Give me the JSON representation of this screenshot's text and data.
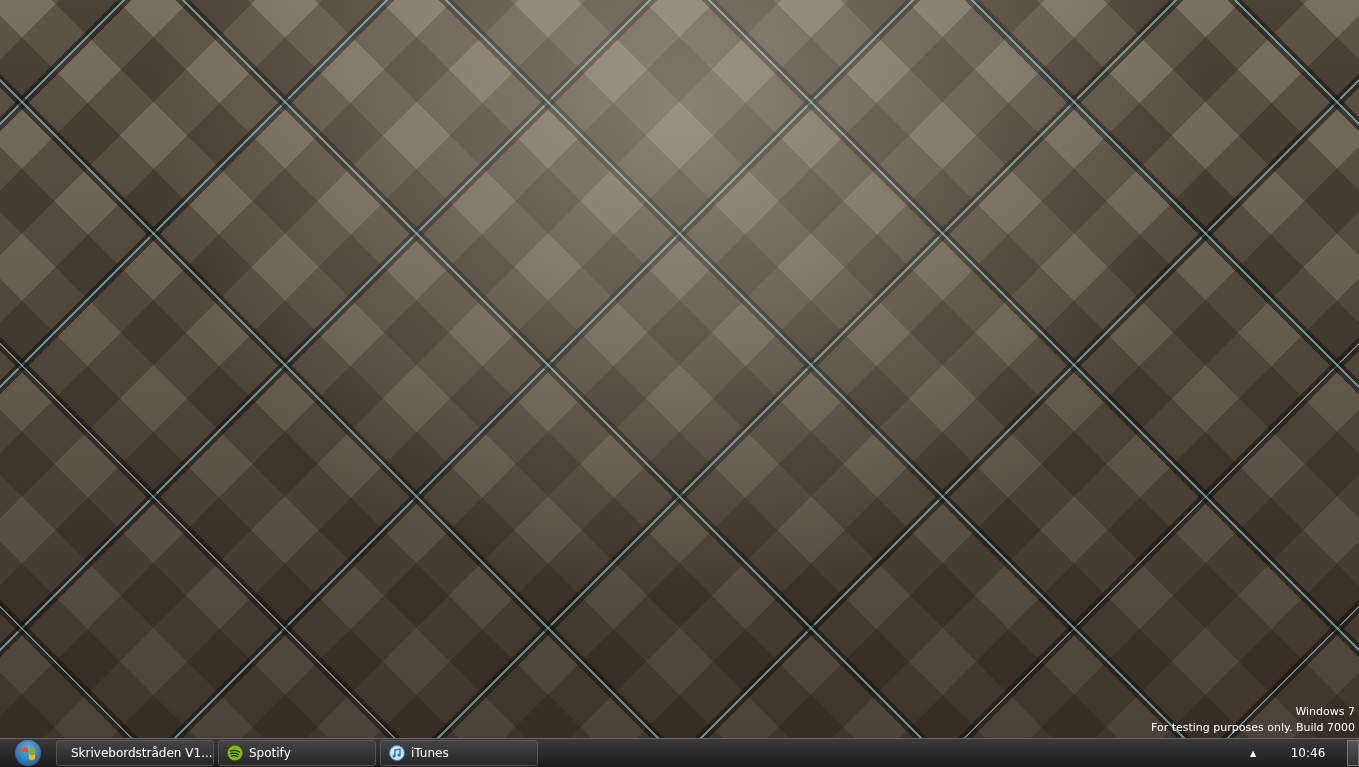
{
  "watermark": {
    "title": "Windows  7",
    "subtitle": "For testing purposes only. Build 7000"
  },
  "taskbar": {
    "buttons": [
      {
        "label": "Skrivebordstråden V1...",
        "kind": "browser"
      },
      {
        "label": "Spotify",
        "kind": "spotify"
      },
      {
        "label": "iTunes",
        "kind": "itunes"
      }
    ],
    "tray_arrow": "▲",
    "clock": "10:46"
  }
}
